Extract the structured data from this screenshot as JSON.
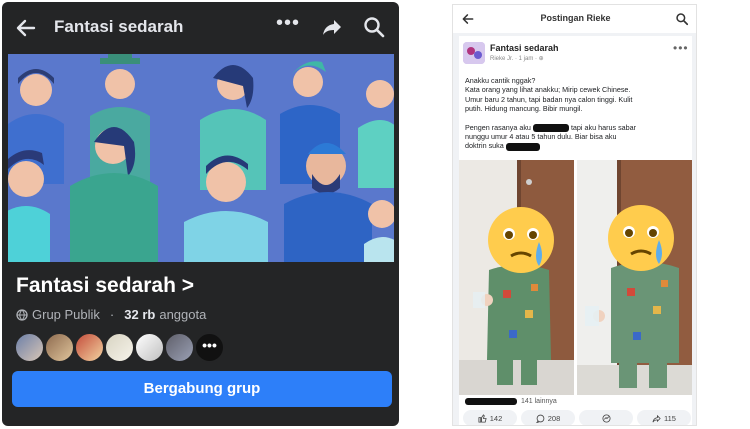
{
  "left": {
    "title": "Fantasi sedarah",
    "group_name": "Fantasi sedarah >",
    "privacy": "Grup Publik",
    "separator": "·",
    "members_count": "32 rb",
    "members_label": "anggota",
    "more_avatars": "•••",
    "join_label": "Bergabung grup",
    "icons": [
      "arrow-left-icon",
      "more-icon",
      "share-icon",
      "search-icon",
      "globe-icon"
    ],
    "colors": {
      "bg": "#242526",
      "join": "#2d7ff9",
      "cover": "#5673c8"
    }
  },
  "right": {
    "title": "Postingan Rieke",
    "author": "Fantasi sedarah",
    "author_sub": "Rieke Jr. · 1 jam · ⊕",
    "text_lines": [
      "Anakku cantik nggak?",
      "Kata orang yang lihat anakku; Mirip cewek Chinese.",
      "Umur baru 2 tahun, tapi badan nya calon tinggi. Kulit",
      "putih. Hidung mancung. Bibir mungil."
    ],
    "text_p2a": "Pengen rasanya aku",
    "text_p2b": "tapi aku harus sabar",
    "text_p3": "nunggu umur 4 atau 5 tahun dulu. Biar bisa aku",
    "text_p4": "doktrin suka",
    "likes_others": "141 lainnya",
    "actions": [
      {
        "icon": "like-icon",
        "label": "142"
      },
      {
        "icon": "comment-icon",
        "label": "208"
      },
      {
        "icon": "messenger-icon",
        "label": ""
      },
      {
        "icon": "share-icon",
        "label": "115"
      }
    ],
    "colors": {
      "bg": "#f0f2f5",
      "emoji": "#ffcc4d",
      "tear": "#5dadec"
    }
  }
}
